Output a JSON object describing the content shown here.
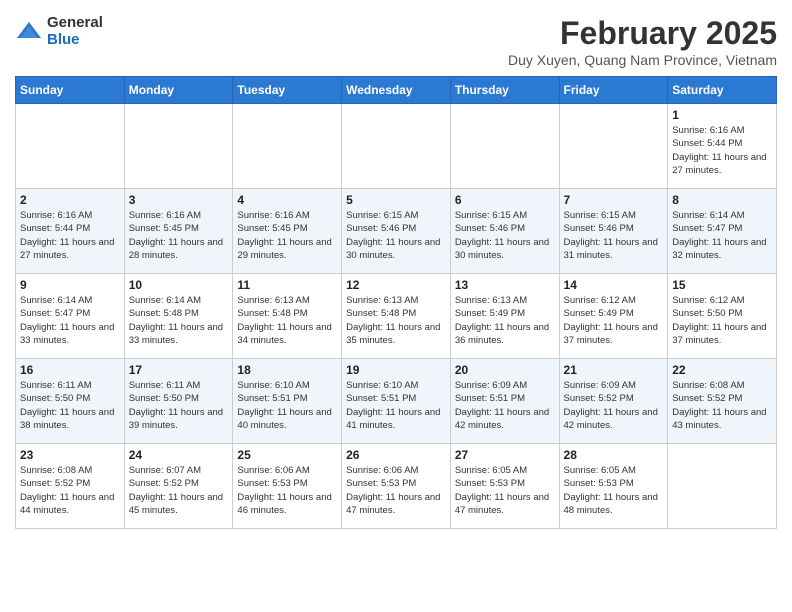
{
  "header": {
    "logo_general": "General",
    "logo_blue": "Blue",
    "month_year": "February 2025",
    "location": "Duy Xuyen, Quang Nam Province, Vietnam"
  },
  "weekdays": [
    "Sunday",
    "Monday",
    "Tuesday",
    "Wednesday",
    "Thursday",
    "Friday",
    "Saturday"
  ],
  "weeks": [
    [
      {
        "day": "",
        "info": ""
      },
      {
        "day": "",
        "info": ""
      },
      {
        "day": "",
        "info": ""
      },
      {
        "day": "",
        "info": ""
      },
      {
        "day": "",
        "info": ""
      },
      {
        "day": "",
        "info": ""
      },
      {
        "day": "1",
        "info": "Sunrise: 6:16 AM\nSunset: 5:44 PM\nDaylight: 11 hours and 27 minutes."
      }
    ],
    [
      {
        "day": "2",
        "info": "Sunrise: 6:16 AM\nSunset: 5:44 PM\nDaylight: 11 hours and 27 minutes."
      },
      {
        "day": "3",
        "info": "Sunrise: 6:16 AM\nSunset: 5:45 PM\nDaylight: 11 hours and 28 minutes."
      },
      {
        "day": "4",
        "info": "Sunrise: 6:16 AM\nSunset: 5:45 PM\nDaylight: 11 hours and 29 minutes."
      },
      {
        "day": "5",
        "info": "Sunrise: 6:15 AM\nSunset: 5:46 PM\nDaylight: 11 hours and 30 minutes."
      },
      {
        "day": "6",
        "info": "Sunrise: 6:15 AM\nSunset: 5:46 PM\nDaylight: 11 hours and 30 minutes."
      },
      {
        "day": "7",
        "info": "Sunrise: 6:15 AM\nSunset: 5:46 PM\nDaylight: 11 hours and 31 minutes."
      },
      {
        "day": "8",
        "info": "Sunrise: 6:14 AM\nSunset: 5:47 PM\nDaylight: 11 hours and 32 minutes."
      }
    ],
    [
      {
        "day": "9",
        "info": "Sunrise: 6:14 AM\nSunset: 5:47 PM\nDaylight: 11 hours and 33 minutes."
      },
      {
        "day": "10",
        "info": "Sunrise: 6:14 AM\nSunset: 5:48 PM\nDaylight: 11 hours and 33 minutes."
      },
      {
        "day": "11",
        "info": "Sunrise: 6:13 AM\nSunset: 5:48 PM\nDaylight: 11 hours and 34 minutes."
      },
      {
        "day": "12",
        "info": "Sunrise: 6:13 AM\nSunset: 5:48 PM\nDaylight: 11 hours and 35 minutes."
      },
      {
        "day": "13",
        "info": "Sunrise: 6:13 AM\nSunset: 5:49 PM\nDaylight: 11 hours and 36 minutes."
      },
      {
        "day": "14",
        "info": "Sunrise: 6:12 AM\nSunset: 5:49 PM\nDaylight: 11 hours and 37 minutes."
      },
      {
        "day": "15",
        "info": "Sunrise: 6:12 AM\nSunset: 5:50 PM\nDaylight: 11 hours and 37 minutes."
      }
    ],
    [
      {
        "day": "16",
        "info": "Sunrise: 6:11 AM\nSunset: 5:50 PM\nDaylight: 11 hours and 38 minutes."
      },
      {
        "day": "17",
        "info": "Sunrise: 6:11 AM\nSunset: 5:50 PM\nDaylight: 11 hours and 39 minutes."
      },
      {
        "day": "18",
        "info": "Sunrise: 6:10 AM\nSunset: 5:51 PM\nDaylight: 11 hours and 40 minutes."
      },
      {
        "day": "19",
        "info": "Sunrise: 6:10 AM\nSunset: 5:51 PM\nDaylight: 11 hours and 41 minutes."
      },
      {
        "day": "20",
        "info": "Sunrise: 6:09 AM\nSunset: 5:51 PM\nDaylight: 11 hours and 42 minutes."
      },
      {
        "day": "21",
        "info": "Sunrise: 6:09 AM\nSunset: 5:52 PM\nDaylight: 11 hours and 42 minutes."
      },
      {
        "day": "22",
        "info": "Sunrise: 6:08 AM\nSunset: 5:52 PM\nDaylight: 11 hours and 43 minutes."
      }
    ],
    [
      {
        "day": "23",
        "info": "Sunrise: 6:08 AM\nSunset: 5:52 PM\nDaylight: 11 hours and 44 minutes."
      },
      {
        "day": "24",
        "info": "Sunrise: 6:07 AM\nSunset: 5:52 PM\nDaylight: 11 hours and 45 minutes."
      },
      {
        "day": "25",
        "info": "Sunrise: 6:06 AM\nSunset: 5:53 PM\nDaylight: 11 hours and 46 minutes."
      },
      {
        "day": "26",
        "info": "Sunrise: 6:06 AM\nSunset: 5:53 PM\nDaylight: 11 hours and 47 minutes."
      },
      {
        "day": "27",
        "info": "Sunrise: 6:05 AM\nSunset: 5:53 PM\nDaylight: 11 hours and 47 minutes."
      },
      {
        "day": "28",
        "info": "Sunrise: 6:05 AM\nSunset: 5:53 PM\nDaylight: 11 hours and 48 minutes."
      },
      {
        "day": "",
        "info": ""
      }
    ]
  ]
}
